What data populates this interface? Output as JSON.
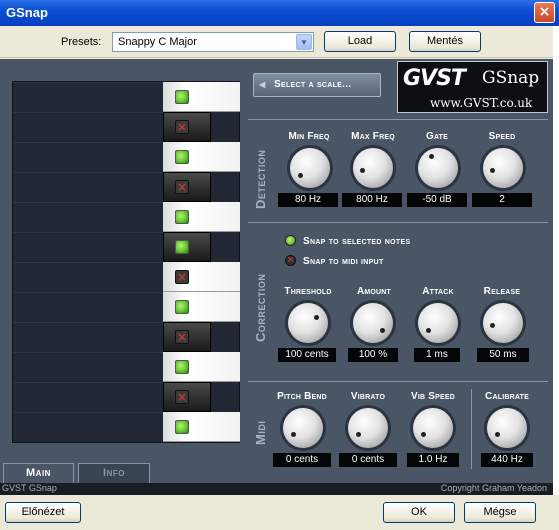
{
  "window": {
    "title": "GSnap",
    "close_glyph": "×"
  },
  "presetbar": {
    "label": "Presets:",
    "selected": "Snappy C Major",
    "load_button": "Load",
    "save_button": "Mentés"
  },
  "plugin": {
    "select_scale": "Select a scale...",
    "logo": {
      "mark": "GVST",
      "name": "GSnap",
      "url": "www.GVST.co.uk"
    },
    "sections": {
      "detection": {
        "title": "Detection",
        "controls": [
          {
            "label": "Min Freq",
            "value": "80 Hz"
          },
          {
            "label": "Max Freq",
            "value": "800 Hz"
          },
          {
            "label": "Gate",
            "value": "-50 dB"
          },
          {
            "label": "Speed",
            "value": "2"
          }
        ]
      },
      "correction": {
        "title": "Correction",
        "options": [
          {
            "label": "Snap to selected notes",
            "selected": true
          },
          {
            "label": "Snap to midi input",
            "selected": false
          }
        ],
        "controls": [
          {
            "label": "Threshold",
            "value": "100 cents"
          },
          {
            "label": "Amount",
            "value": "100 %"
          },
          {
            "label": "Attack",
            "value": "1 ms"
          },
          {
            "label": "Release",
            "value": "50 ms"
          }
        ]
      },
      "midi": {
        "title": "Midi",
        "controls": [
          {
            "label": "Pitch Bend",
            "value": "0 cents"
          },
          {
            "label": "Vibrato",
            "value": "0 cents"
          },
          {
            "label": "Vib Speed",
            "value": "1.0 Hz"
          }
        ],
        "calibrate": {
          "label": "Calibrate",
          "value": "440 Hz"
        }
      }
    },
    "keys": [
      {
        "color": "white",
        "enabled": true
      },
      {
        "color": "black",
        "enabled": false
      },
      {
        "color": "white",
        "enabled": true
      },
      {
        "color": "black",
        "enabled": false
      },
      {
        "color": "white",
        "enabled": true
      },
      {
        "color": "black",
        "enabled": true
      },
      {
        "color": "white",
        "enabled": false
      },
      {
        "color": "white",
        "enabled": true
      },
      {
        "color": "black",
        "enabled": false
      },
      {
        "color": "white",
        "enabled": true
      },
      {
        "color": "black",
        "enabled": false
      },
      {
        "color": "white",
        "enabled": true
      }
    ],
    "tabs": [
      {
        "label": "Main",
        "active": true
      },
      {
        "label": "Info",
        "active": false
      }
    ],
    "footer": {
      "left": "GVST GSnap",
      "right": "Copyright Graham Yeadon"
    }
  },
  "bottombar": {
    "preview_button": "Előnézet",
    "ok_button": "OK",
    "cancel_button": "Mégse"
  },
  "colors": {
    "panel": "#4a5566",
    "led_on": "#5cc42a",
    "led_off_x": "#c23a2a",
    "titlebar": "#0a4fd4"
  }
}
